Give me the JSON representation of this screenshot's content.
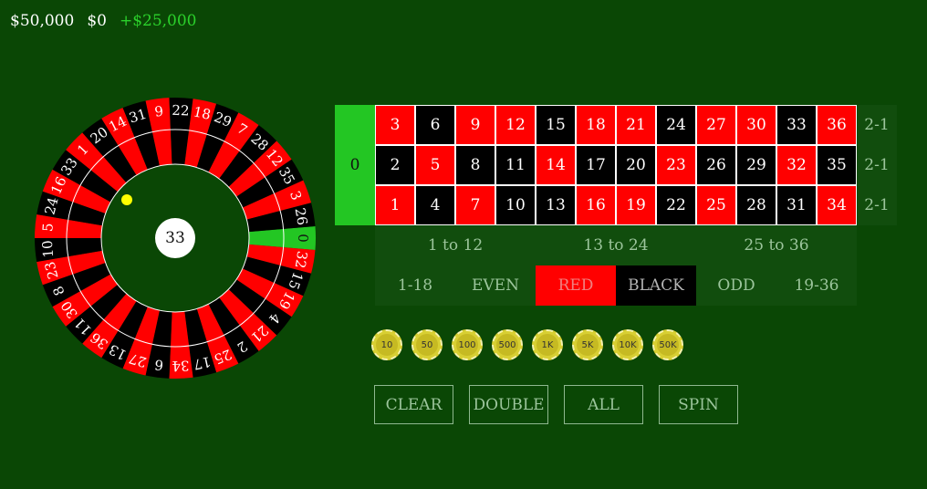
{
  "hud": {
    "balance": "$50,000",
    "bet": "$0",
    "last_win": "+$25,000"
  },
  "wheel": {
    "order": [
      0,
      32,
      15,
      19,
      4,
      21,
      2,
      25,
      17,
      34,
      6,
      27,
      13,
      36,
      11,
      30,
      8,
      23,
      10,
      5,
      24,
      16,
      33,
      1,
      20,
      14,
      31,
      9,
      22,
      18,
      29,
      7,
      28,
      12,
      35,
      3,
      26
    ],
    "reds": [
      1,
      3,
      5,
      7,
      9,
      12,
      14,
      16,
      18,
      19,
      21,
      23,
      25,
      27,
      30,
      32,
      34,
      36
    ],
    "center_number": "33",
    "colors": {
      "red": "#ff0000",
      "black": "#000000",
      "green": "#23c623",
      "inner": "#0a4705"
    }
  },
  "board": {
    "zero": "0",
    "rows": [
      [
        3,
        6,
        9,
        12,
        15,
        18,
        21,
        24,
        27,
        30,
        33,
        36
      ],
      [
        2,
        5,
        8,
        11,
        14,
        17,
        20,
        23,
        26,
        29,
        32,
        35
      ],
      [
        1,
        4,
        7,
        10,
        13,
        16,
        19,
        22,
        25,
        28,
        31,
        34
      ]
    ],
    "columns": [
      "2-1",
      "2-1",
      "2-1"
    ],
    "dozens": [
      "1 to 12",
      "13 to 24",
      "25 to 36"
    ],
    "outside": [
      "1-18",
      "EVEN",
      "RED",
      "BLACK",
      "ODD",
      "19-36"
    ]
  },
  "chips": [
    "10",
    "50",
    "100",
    "500",
    "1K",
    "5K",
    "10K",
    "50K"
  ],
  "buttons": {
    "clear": "CLEAR",
    "double": "DOUBLE",
    "all": "ALL",
    "spin": "SPIN"
  }
}
